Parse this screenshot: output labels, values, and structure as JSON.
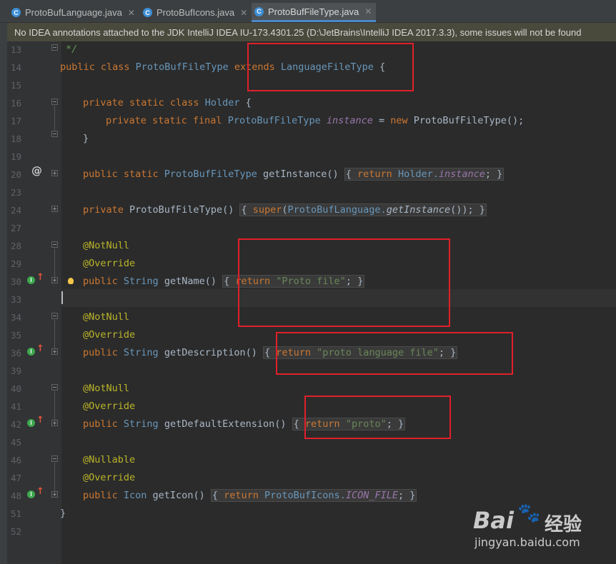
{
  "tabs": [
    {
      "label": "ProtoBufLanguage.java",
      "active": false
    },
    {
      "label": "ProtoBufIcons.java",
      "active": false
    },
    {
      "label": "ProtoBufFileType.java",
      "active": true
    }
  ],
  "banner": "No IDEA annotations attached to the JDK IntelliJ IDEA IU-173.4301.25 (D:\\JetBrains\\IntelliJ IDEA 2017.3.3), some issues will not be found",
  "line_numbers": [
    "13",
    "14",
    "15",
    "16",
    "17",
    "18",
    "19",
    "20",
    "23",
    "24",
    "27",
    "28",
    "29",
    "30",
    "33",
    "34",
    "35",
    "36",
    "39",
    "40",
    "41",
    "42",
    "45",
    "46",
    "47",
    "48",
    "51",
    "52"
  ],
  "code": {
    "l13": "*/",
    "l14_a": "public class ",
    "l14_b": "ProtoBufFileType ",
    "l14_c": "extends ",
    "l14_d": "LanguageFileType",
    "l14_e": " {",
    "l16_a": "private static class ",
    "l16_b": "Holder",
    "l16_c": " {",
    "l17_a": "private static final ",
    "l17_b": "ProtoBufFileType ",
    "l17_c": "instance",
    "l17_d": " = ",
    "l17_e": "new ",
    "l17_f": "ProtoBufFileType();",
    "l18": "}",
    "l20_a": "public static ",
    "l20_b": "ProtoBufFileType ",
    "l20_c": "getInstance",
    "l20_d": "() ",
    "l20_e": "{ ",
    "l20_f": "return ",
    "l20_g": "Holder.",
    "l20_h": "instance",
    "l20_i": "; }",
    "l24_a": "private ",
    "l24_b": "ProtoBufFileType",
    "l24_c": "() ",
    "l24_d": "{ ",
    "l24_e": "super",
    "l24_f": "(",
    "l24_g": "ProtoBufLanguage.",
    "l24_h": "getInstance",
    "l24_i": "()); }",
    "notnull": "@NotNull",
    "override": "@Override",
    "nullable": "@Nullable",
    "public": "public ",
    "string": "String ",
    "l30_fn": "getName",
    "l30_rest": "() ",
    "l30_br": "{ ",
    "ret": "return ",
    "l30_str": "\"Proto file\"",
    "semi_close": "; }",
    "l36_fn": "getDescription",
    "l36_str": "\"proto language file\"",
    "l42_fn": "getDefaultExtension",
    "l42_str": "\"proto\"",
    "l48_type": "Icon ",
    "l48_fn": "getIcon",
    "l48_cls": "ProtoBufIcons.",
    "l48_fld": "ICON_FILE",
    "l51": "}"
  },
  "watermark": {
    "brand": "Bai",
    "brand_cn": "经验",
    "url": "jingyan.baidu.com"
  },
  "colors": {
    "highlight_box": "#e0202a",
    "keyword": "#cc7832",
    "string": "#6a8759",
    "annotation": "#bbb529"
  }
}
